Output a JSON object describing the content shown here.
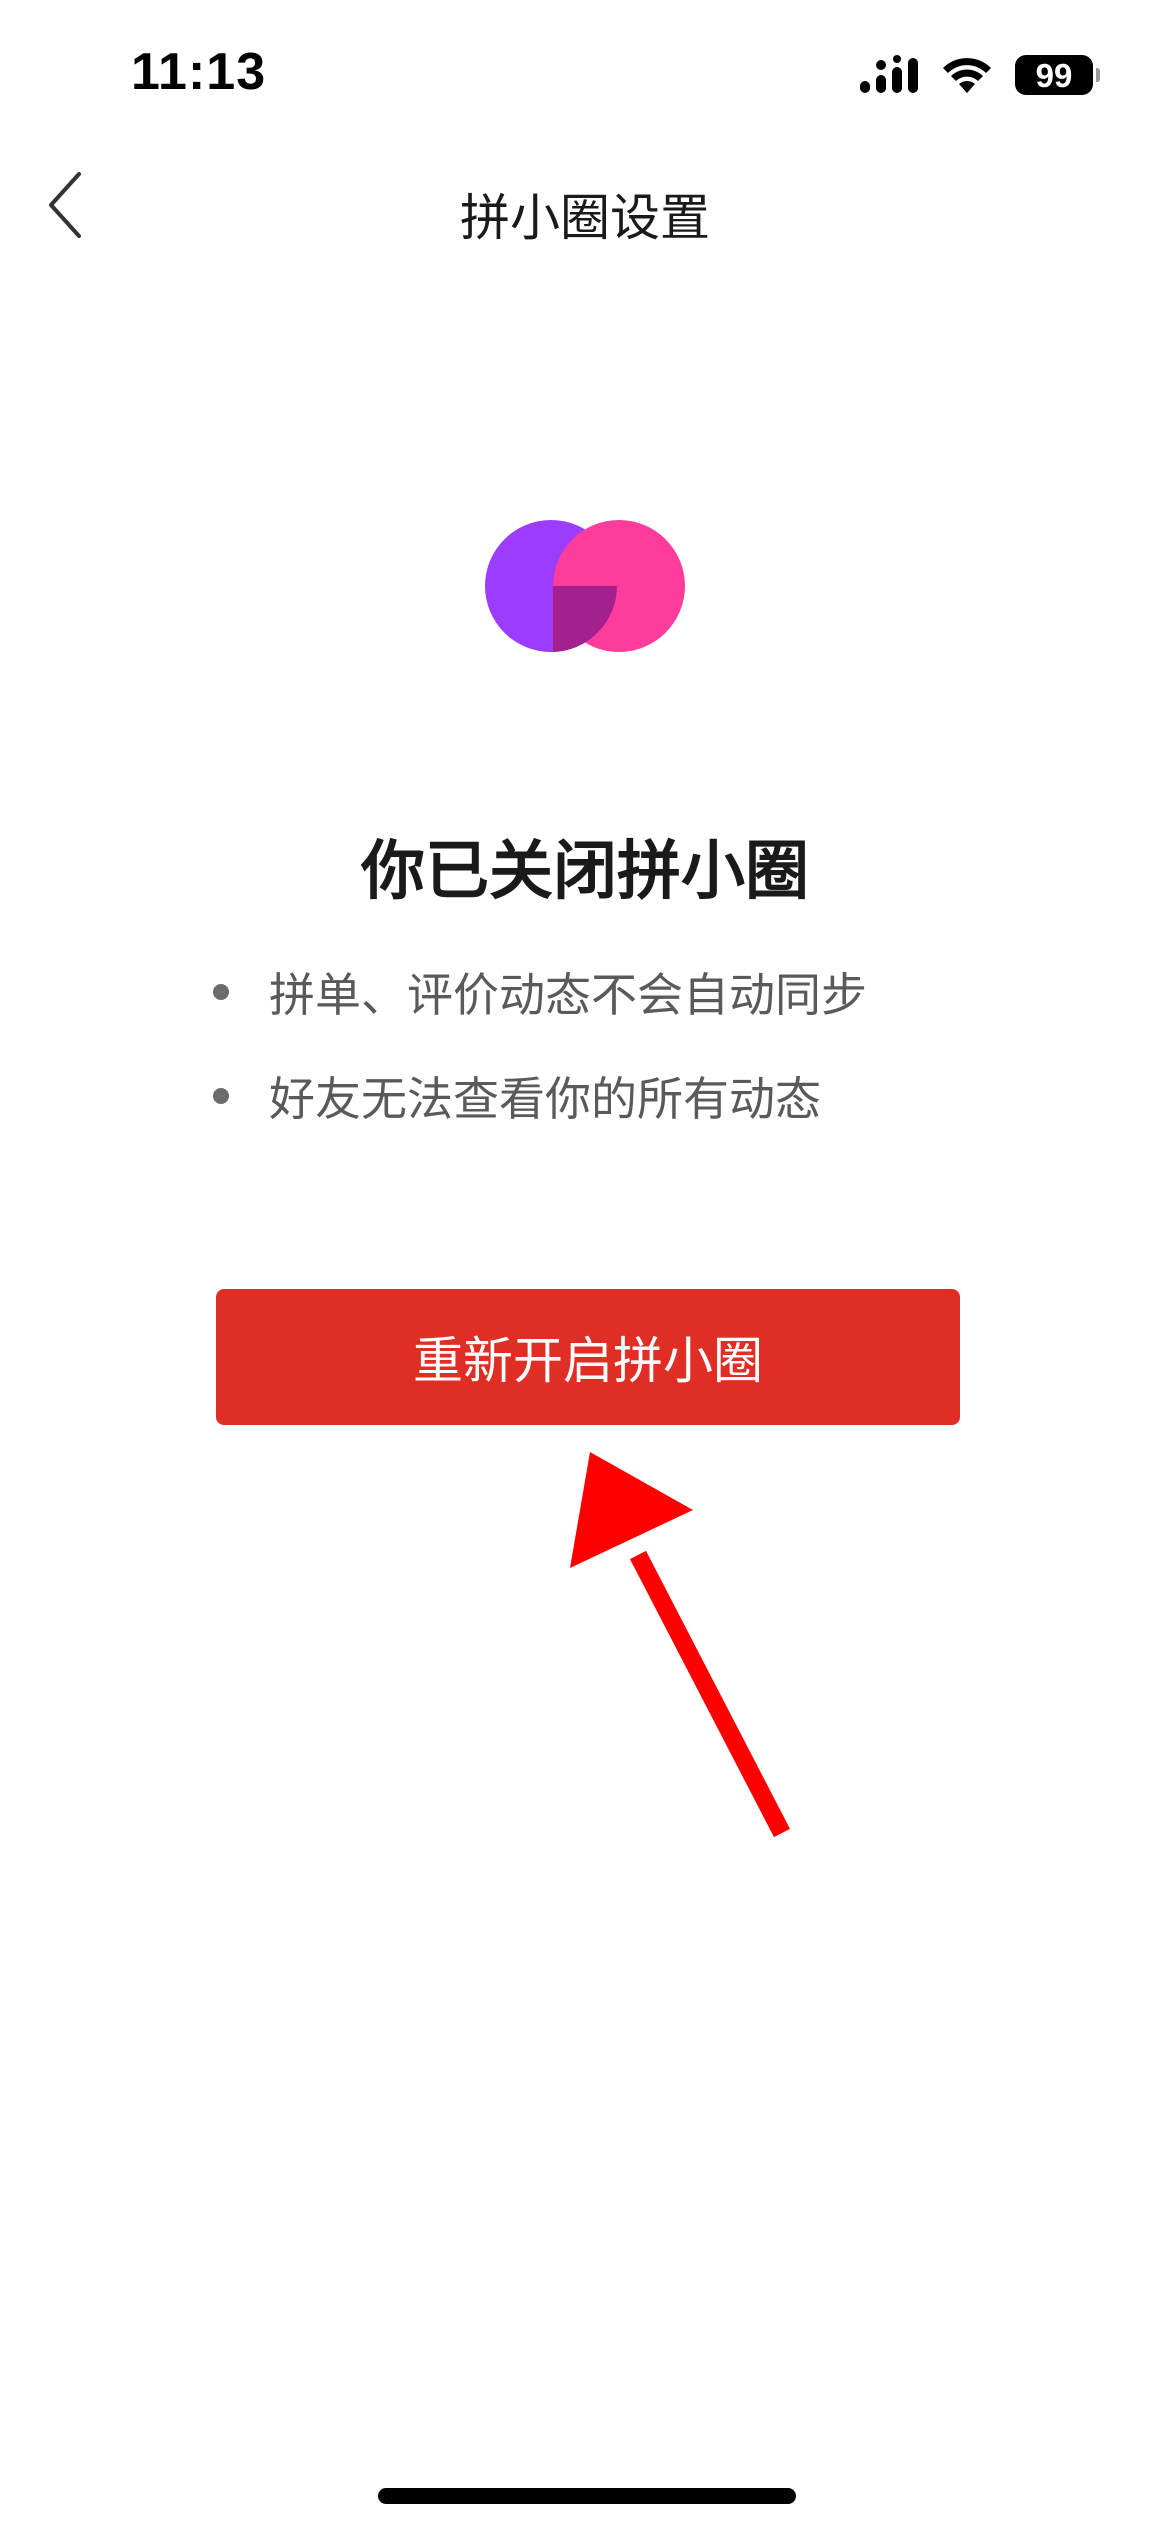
{
  "status_bar": {
    "time": "11:13",
    "battery": "99",
    "icons": [
      "cellular-signal-icon",
      "wifi-icon",
      "battery-icon"
    ]
  },
  "nav": {
    "back_icon": "chevron-left-icon",
    "title": "拼小圈设置"
  },
  "logo": {
    "icon": "pinxiaoquan-logo-icon",
    "colors": {
      "left_circle": "#9b3cff",
      "right_circle": "#ff3c9b",
      "overlap": "#a4208f"
    }
  },
  "main": {
    "heading": "你已关闭拼小圈",
    "bullets": [
      "拼单、评价动态不会自动同步",
      "好友无法查看你的所有动态"
    ],
    "reopen_button_label": "重新开启拼小圈"
  },
  "annotation": {
    "icon": "red-arrow-icon",
    "color": "#ff0000"
  },
  "colors": {
    "primary_button": "#e02e24",
    "heading_text": "#1a1a1a",
    "bullet_text": "#5a5a5a"
  }
}
